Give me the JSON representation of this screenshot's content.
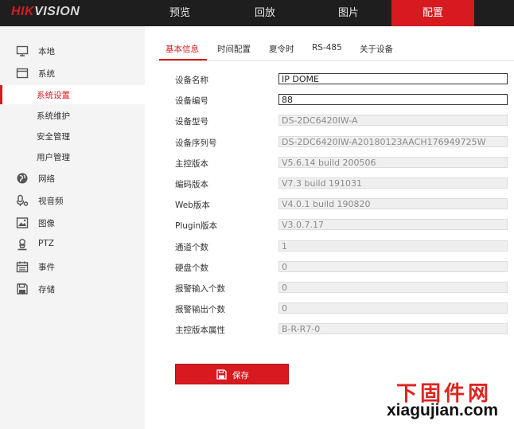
{
  "brand": {
    "part1": "HIK",
    "part2": "VISION"
  },
  "nav": [
    {
      "label": "预览"
    },
    {
      "label": "回放"
    },
    {
      "label": "图片"
    },
    {
      "label": "配置"
    }
  ],
  "sidebar": {
    "local": "本地",
    "system": "系统",
    "system_settings": "系统设置",
    "system_maintenance": "系统维护",
    "security": "安全管理",
    "users": "用户管理",
    "network": "网络",
    "video_audio": "视音频",
    "image": "图像",
    "ptz": "PTZ",
    "event": "事件",
    "storage": "存储"
  },
  "tabs": [
    "基本信息",
    "时间配置",
    "夏令时",
    "RS-485",
    "关于设备"
  ],
  "form": {
    "rows": [
      {
        "label": "设备名称",
        "value": "IP DOME"
      },
      {
        "label": "设备编号",
        "value": "88"
      },
      {
        "label": "设备型号",
        "value": "DS-2DC6420IW-A"
      },
      {
        "label": "设备序列号",
        "value": "DS-2DC6420IW-A20180123AACH176949725W"
      },
      {
        "label": "主控版本",
        "value": "V5.6.14 build 200506"
      },
      {
        "label": "编码版本",
        "value": "V7.3 build 191031"
      },
      {
        "label": "Web版本",
        "value": "V4.0.1 build 190820"
      },
      {
        "label": "Plugin版本",
        "value": "V3.0.7.17"
      },
      {
        "label": "通道个数",
        "value": "1"
      },
      {
        "label": "硬盘个数",
        "value": "0"
      },
      {
        "label": "报警输入个数",
        "value": "0"
      },
      {
        "label": "报警输出个数",
        "value": "0"
      },
      {
        "label": "主控版本属性",
        "value": "B-R-R7-0"
      }
    ]
  },
  "save_label": "保存",
  "watermark": {
    "cn": "下固件网",
    "url": "xiagujian.com"
  },
  "colors": {
    "accent": "#d61a20",
    "topbar": "#1e1e1e",
    "sidebar": "#f4f4f4"
  }
}
